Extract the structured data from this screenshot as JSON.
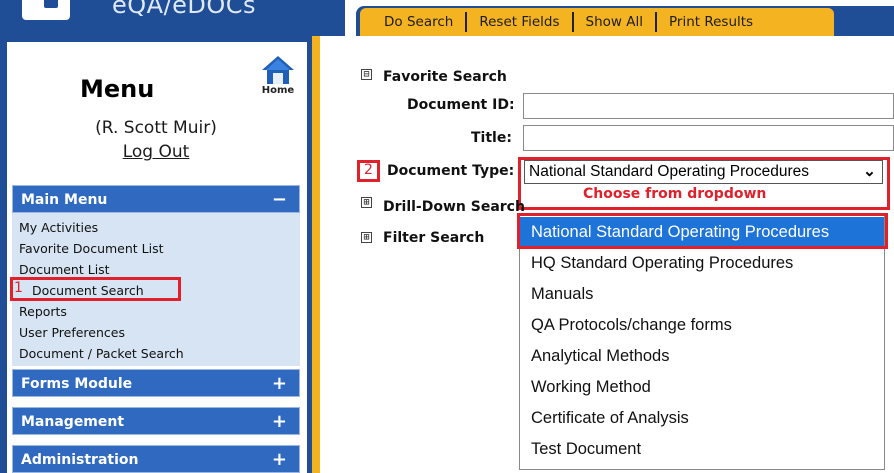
{
  "app": {
    "title": "eQA/eDOCs"
  },
  "toolbar": {
    "buttons": [
      "Do Search",
      "Reset Fields",
      "Show All",
      "Print Results"
    ]
  },
  "sidebar": {
    "menu_title": "Menu",
    "home_label": "Home",
    "user_name": "(R. Scott Muir)",
    "logout": "Log Out",
    "sections": [
      {
        "label": "Main Menu",
        "sign": "−"
      },
      {
        "label": "Forms Module",
        "sign": "+"
      },
      {
        "label": "Management",
        "sign": "+"
      },
      {
        "label": "Administration",
        "sign": "+"
      }
    ],
    "main_menu_items": [
      "My Activities",
      "Favorite Document List",
      "Document List",
      "Document Search",
      "Reports",
      "User Preferences",
      "Document / Packet Search"
    ]
  },
  "annotations": {
    "step1": "1",
    "step2": "2",
    "hint": "Choose from dropdown"
  },
  "search": {
    "favorite_label": "Favorite Search",
    "document_id_label": "Document ID:",
    "title_label": "Title:",
    "document_type_label": "Document Type:",
    "document_type_value": "National Standard Operating Procedures",
    "drilldown_label": "Drill-Down Search",
    "filter_label": "Filter Search",
    "expander_minus": "⊟",
    "expander_plus": "⊞"
  },
  "dropdown_options": [
    "National Standard Operating Procedures",
    "HQ Standard Operating Procedures",
    "Manuals",
    "QA Protocols/change forms",
    "Analytical Methods",
    "Working Method",
    "Certificate of Analysis",
    "Test Document"
  ],
  "colors": {
    "brand_blue": "#1f4e96",
    "accent_gold": "#f4b321",
    "annotation_red": "#e0202a",
    "selected_blue": "#1e73d8"
  }
}
